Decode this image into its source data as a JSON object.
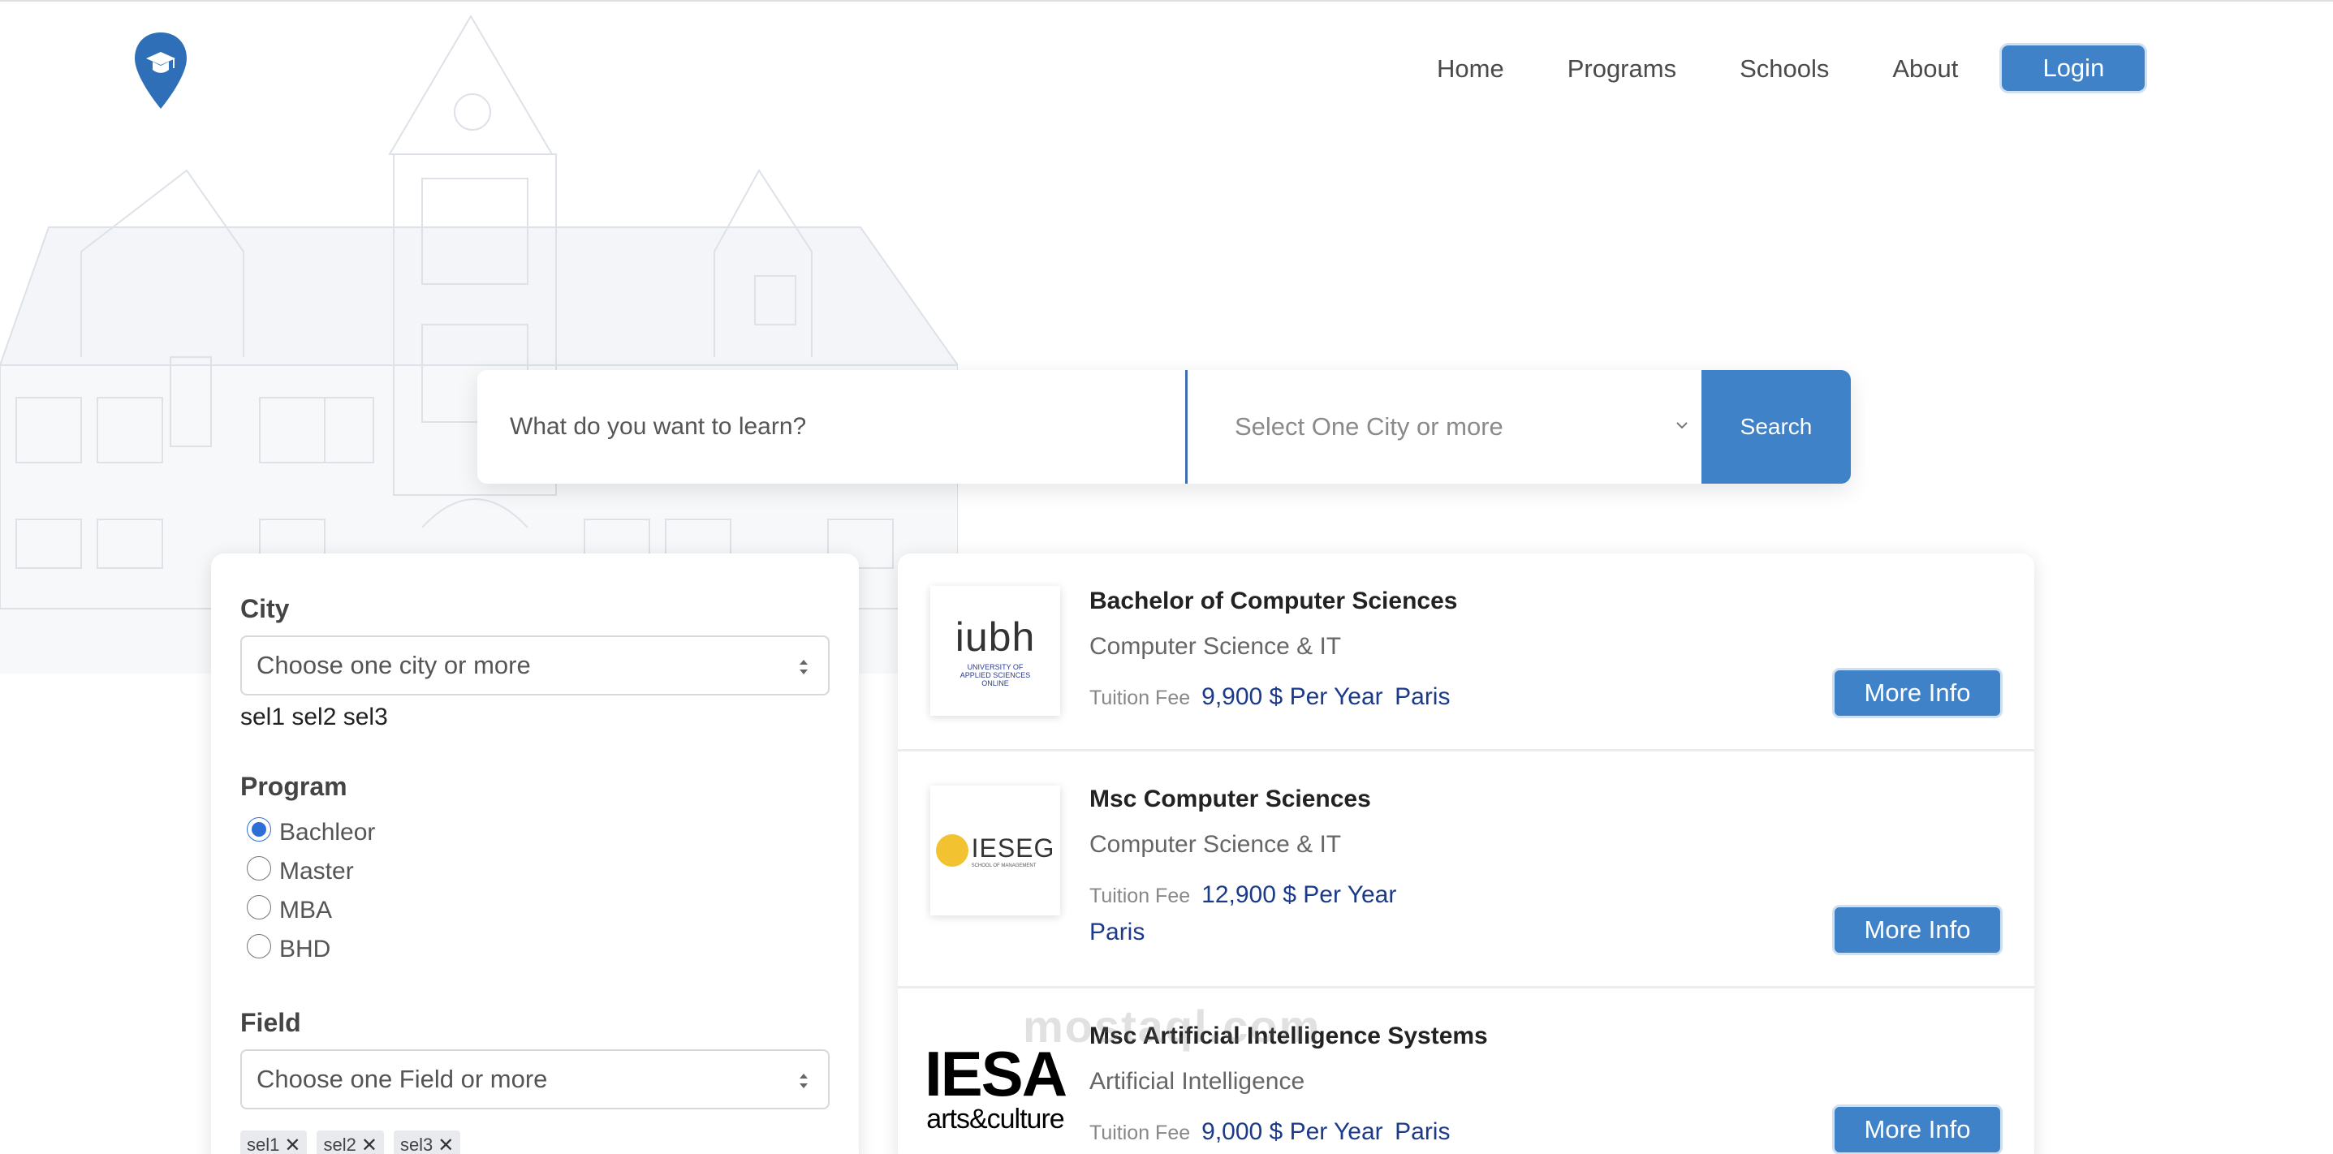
{
  "nav": {
    "links": [
      "Home",
      "Programs",
      "Schools",
      "About"
    ],
    "login_label": "Login"
  },
  "search": {
    "placeholder": "What do you want to learn?",
    "city_placeholder": "Select One City or more",
    "button_label": "Search"
  },
  "filters": {
    "city": {
      "heading": "City",
      "placeholder": "Choose one city or more",
      "selected_text": "sel1 sel2 sel3"
    },
    "program": {
      "heading": "Program",
      "options": [
        "Bachleor",
        "Master",
        "MBA",
        "BHD"
      ],
      "selected": "Bachleor"
    },
    "field": {
      "heading": "Field",
      "placeholder": "Choose one Field or more",
      "chips": [
        "sel1",
        "sel2",
        "sel3"
      ]
    }
  },
  "results": [
    {
      "logo_text": "iubh",
      "logo_subtext": "UNIVERSITY OF APPLIED SCIENCES ONLINE",
      "title": "Bachelor of Computer Sciences",
      "field": "Computer Science & IT",
      "fee_label": "Tuition Fee",
      "fee": "9,900 $ Per Year",
      "city": "Paris",
      "button_label": "More Info"
    },
    {
      "logo_text": "IESEG",
      "logo_subtext": "SCHOOL OF MANAGEMENT",
      "title": "Msc Computer Sciences",
      "field": "Computer Science & IT",
      "fee_label": "Tuition Fee",
      "fee": "12,900 $ Per Year",
      "city": "Paris",
      "button_label": "More Info"
    },
    {
      "logo_text": "IESA",
      "logo_subtext": "arts&culture",
      "title": "Msc Artificial Intelligence Systems",
      "field": "Artificial Intelligence",
      "fee_label": "Tuition Fee",
      "fee": "9,000 $ Per Year",
      "city": "Paris",
      "button_label": "More Info"
    }
  ],
  "watermark": "mostaql.com",
  "icons": {
    "logo": "graduation-cap-pin-icon",
    "select_arrow": "chevron-down-icon",
    "select_updown": "sort-arrows-icon",
    "chip_remove": "close-icon"
  },
  "colors": {
    "primary": "#3f82c8",
    "fee_text": "#1b3a8a",
    "radio_accent": "#2d6fd6"
  }
}
